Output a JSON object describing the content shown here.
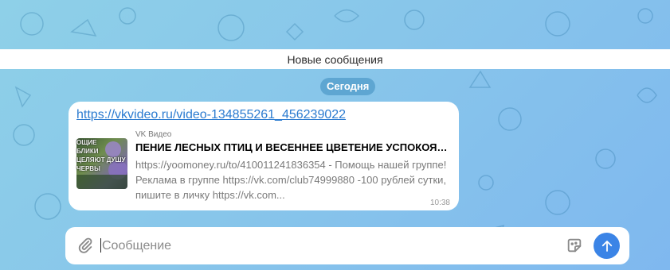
{
  "chat": {
    "new_messages_label": "Новые сообщения",
    "date_label": "Сегодня"
  },
  "message": {
    "link": "https://vkvideo.ru/video-134855261_456239022",
    "time": "10:38",
    "preview": {
      "site": "VK Видео",
      "title": "ПЕНИЕ ЛЕСНЫХ ПТИЦ И ВЕСЕННЕЕ ЦВЕТЕНИЕ УСПОКОЯЮТ ВАШУ ДУШУ",
      "description": "https://yoomoney.ru/to/410011241836354 - Помощь нашей группе! Реклама в группе https://vk.com/club74999880 -100 рублей сутки, пишите в личку https://vk.com...",
      "thumb_text": "ОЩИЕ\nБЛИКИ\nЦЕЛЯЮТ ДУШУ\nЧЕРВЫ"
    }
  },
  "composer": {
    "placeholder": "Сообщение",
    "icons": {
      "attach": "paperclip-icon",
      "sticker": "sticker-icon",
      "send": "send-arrow-icon"
    }
  },
  "colors": {
    "accent": "#3b84e6",
    "link": "#2b7bd0",
    "background": "#88c6ea"
  }
}
